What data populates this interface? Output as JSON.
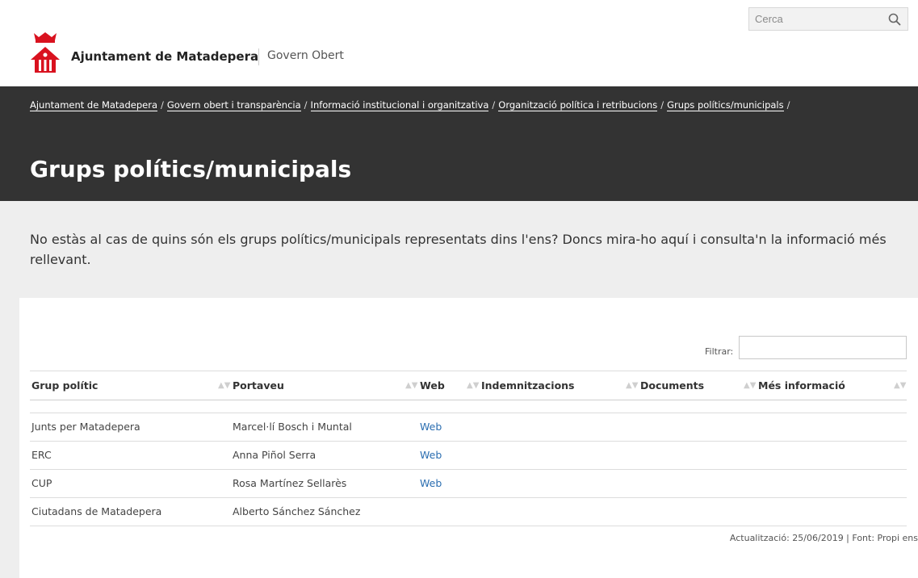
{
  "search": {
    "placeholder": "Cerca",
    "icon": "search-icon"
  },
  "brand": {
    "name": "Ajuntament de Matadepera",
    "section": "Govern Obert",
    "logo_icon": "municipal-crest-icon"
  },
  "breadcrumb": [
    "Ajuntament de Matadepera",
    "Govern obert i transparència",
    "Informació institucional i organitzativa",
    "Organització política i retribucions",
    "Grups polítics/municipals"
  ],
  "breadcrumb_separator": "/",
  "page_title": "Grups polítics/municipals",
  "intro": "No estàs al cas de quins són els grups polítics/municipals representats dins l'ens? Doncs mira-ho aquí i consulta'n la informació més rellevant.",
  "filter": {
    "label": "Filtrar:",
    "value": ""
  },
  "table": {
    "columns": [
      "Grup polític",
      "Portaveu",
      "Web",
      "Indemnitzacions",
      "Documents",
      "Més informació"
    ],
    "rows": [
      {
        "group": "Junts per Matadepera",
        "spokesperson": "Marcel·lí Bosch i Muntal",
        "web": "Web"
      },
      {
        "group": "ERC",
        "spokesperson": "Anna Piñol Serra",
        "web": "Web"
      },
      {
        "group": "CUP",
        "spokesperson": "Rosa Martínez Sellarès",
        "web": "Web"
      },
      {
        "group": "Ciutadans de Matadepera",
        "spokesperson": "Alberto Sánchez Sánchez",
        "web": ""
      }
    ]
  },
  "footnote": "Actualització: 25/06/2019 | Font: Propi ens",
  "colors": {
    "hero_bg": "#333333",
    "page_bg": "#eeeeee",
    "link": "#2a6db0",
    "crest_red": "#d9121f"
  }
}
